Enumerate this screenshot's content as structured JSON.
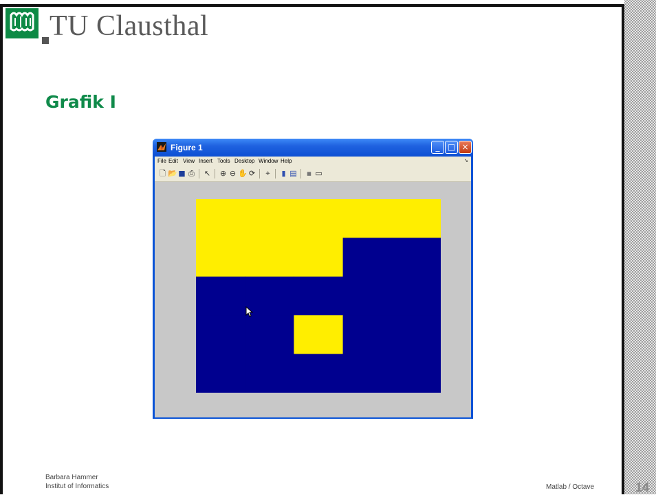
{
  "header": {
    "brand": "TU Clausthal"
  },
  "slide": {
    "title": "Grafik I"
  },
  "figure_window": {
    "title": "Figure 1",
    "menu": [
      "File",
      "Edit",
      "View",
      "Insert",
      "Tools",
      "Desktop",
      "Window",
      "Help"
    ],
    "toolbar_icons": [
      "new-file-icon",
      "open-folder-icon",
      "save-icon",
      "print-icon",
      "select-arrow-icon",
      "zoom-in-icon",
      "zoom-out-icon",
      "pan-hand-icon",
      "rotate-3d-icon",
      "data-cursor-icon",
      "colorbar-icon",
      "legend-icon",
      "hide-plot-tools-icon",
      "show-plot-tools-icon"
    ],
    "plot": {
      "type": "heatmap",
      "grid_rows": 5,
      "grid_cols": 5,
      "values": [
        [
          1,
          1,
          1,
          1,
          1
        ],
        [
          1,
          1,
          1,
          0,
          0
        ],
        [
          0,
          0,
          0,
          0,
          0
        ],
        [
          0,
          0,
          1,
          0,
          0
        ],
        [
          0,
          0,
          0,
          0,
          0
        ]
      ],
      "colors": {
        "0": "#00008f",
        "1": "#ffee00"
      },
      "background": "#c8c8c8"
    }
  },
  "footer": {
    "author": "Barbara Hammer",
    "institute": "Institut of Informatics",
    "course": "Matlab / Octave",
    "page": "14"
  },
  "theme": {
    "brand_green": "#0f8a4a",
    "titlebar_blue": "#0d4fd3"
  }
}
